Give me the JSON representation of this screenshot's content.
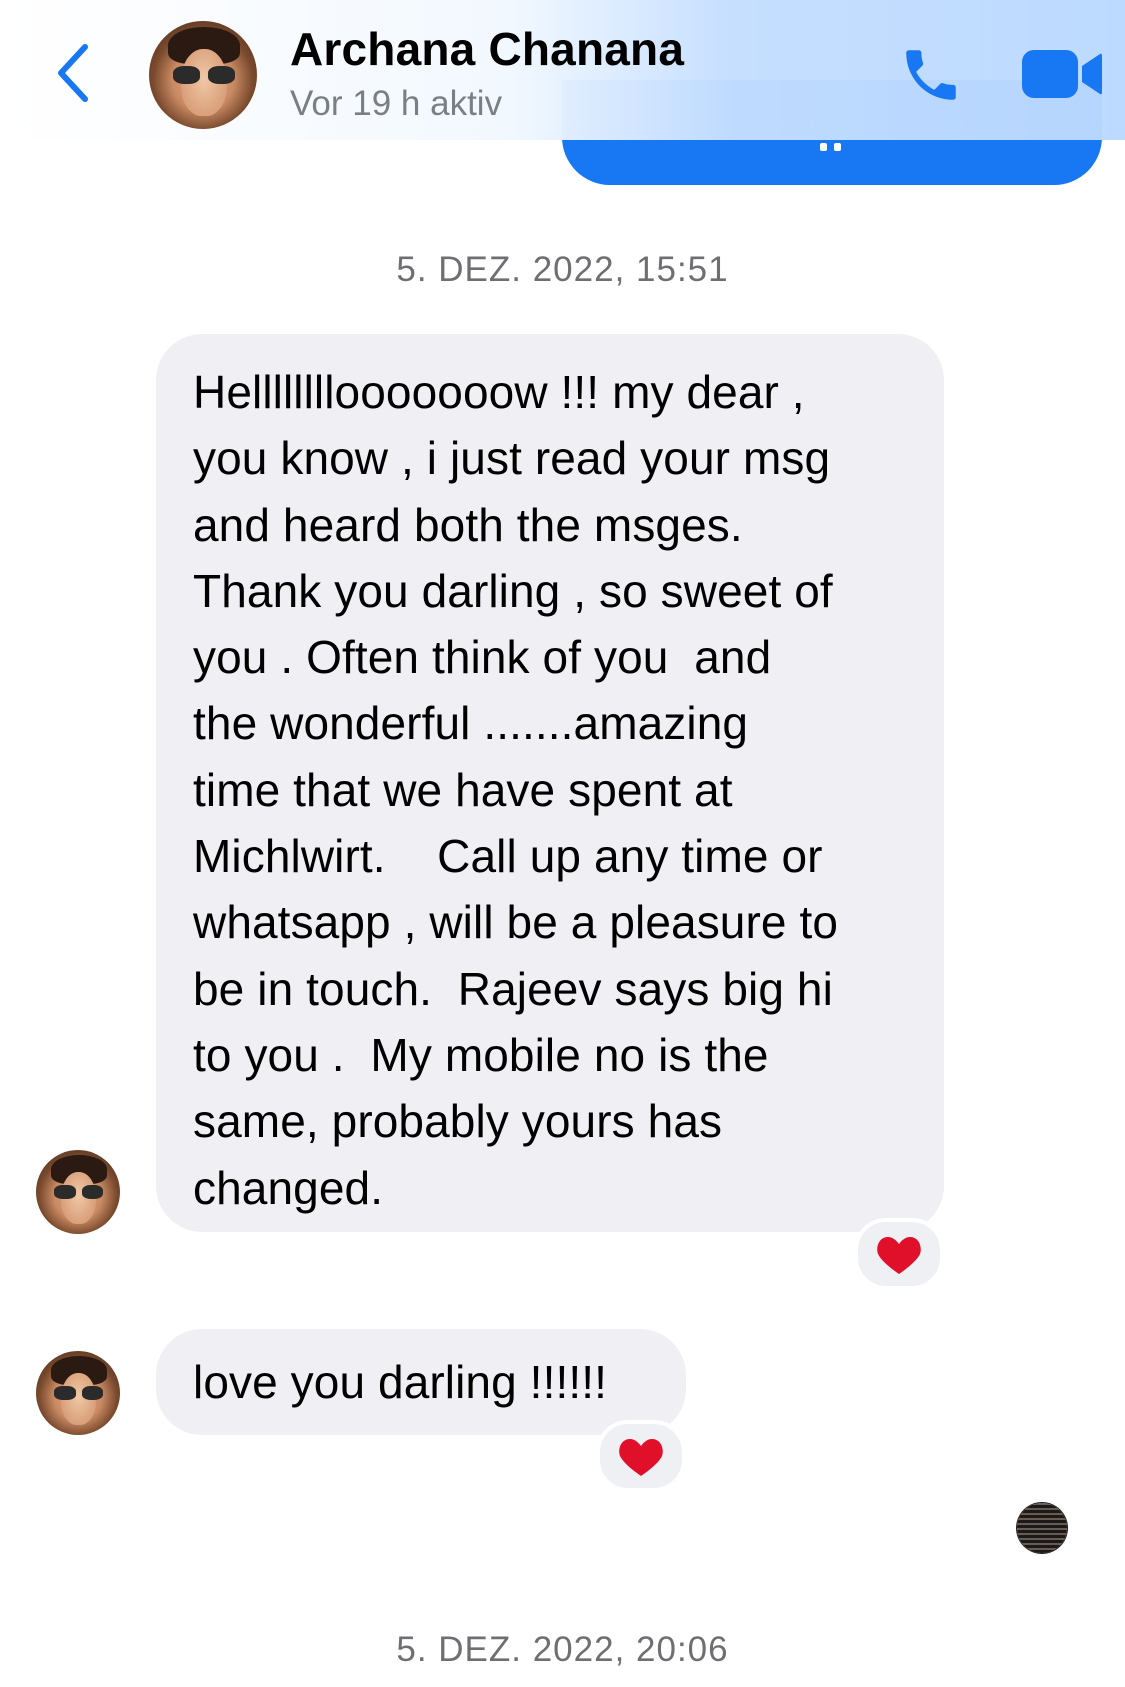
{
  "header": {
    "contact_name": "Archana Chanana",
    "status": "Vor 19 h aktiv"
  },
  "messages": [
    {
      "timestamp": "5. DEZ. 2022, 15:51",
      "text": "Hellllllllooooooow !!! my dear ,\nyou know , i just read your msg\nand heard both the msges.\nThank you darling , so sweet of\nyou . Often think of you  and\nthe wonderful .......amazing\ntime that we have spent at\nMichlwirt.    Call up any time or\nwhatsapp , will be a pleasure to\nbe in touch.  Rajeev says big hi\nto you .  My mobile no is the\nsame, probably yours has\nchanged.",
      "reaction": "❤️"
    },
    {
      "text": "love you darling !!!!!!",
      "reaction": "❤️"
    }
  ],
  "footer_timestamp": "5. DEZ. 2022, 20:06",
  "colors": {
    "accent": "#1877f2",
    "incoming_bubble": "#f0f0f4",
    "heart": "#e0102a"
  }
}
